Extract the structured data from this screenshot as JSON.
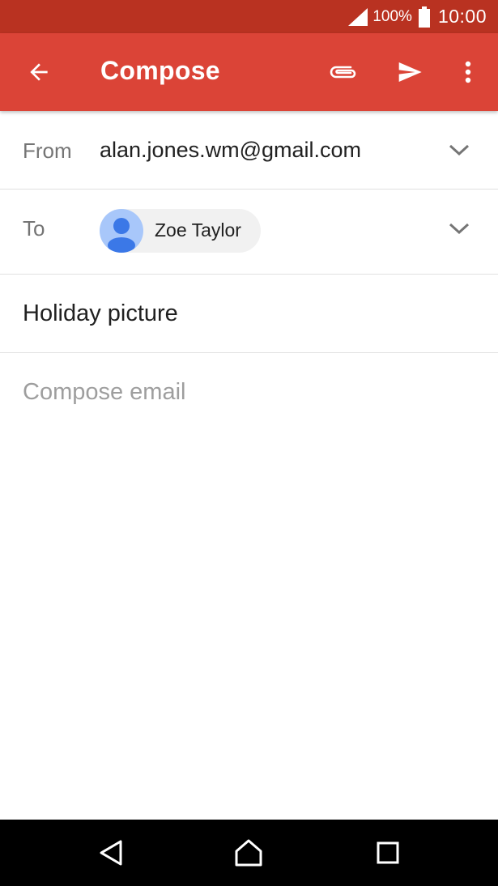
{
  "status_bar": {
    "battery_percent": "100%",
    "time": "10:00",
    "icons": [
      "signal-icon",
      "battery-icon"
    ]
  },
  "app_bar": {
    "title": "Compose",
    "icons": [
      "back-arrow-icon",
      "paperclip-icon",
      "send-icon",
      "more-vert-icon"
    ],
    "color": "#db4437",
    "status_color": "#b93221"
  },
  "compose": {
    "from_label": "From",
    "from_value": "alan.jones.wm@gmail.com",
    "to_label": "To",
    "recipient_name": "Zoe Taylor",
    "subject": "Holiday picture",
    "body_placeholder": "Compose email"
  },
  "nav_bar": {
    "icons": [
      "nav-back-icon",
      "nav-home-icon",
      "nav-recent-icon"
    ]
  }
}
